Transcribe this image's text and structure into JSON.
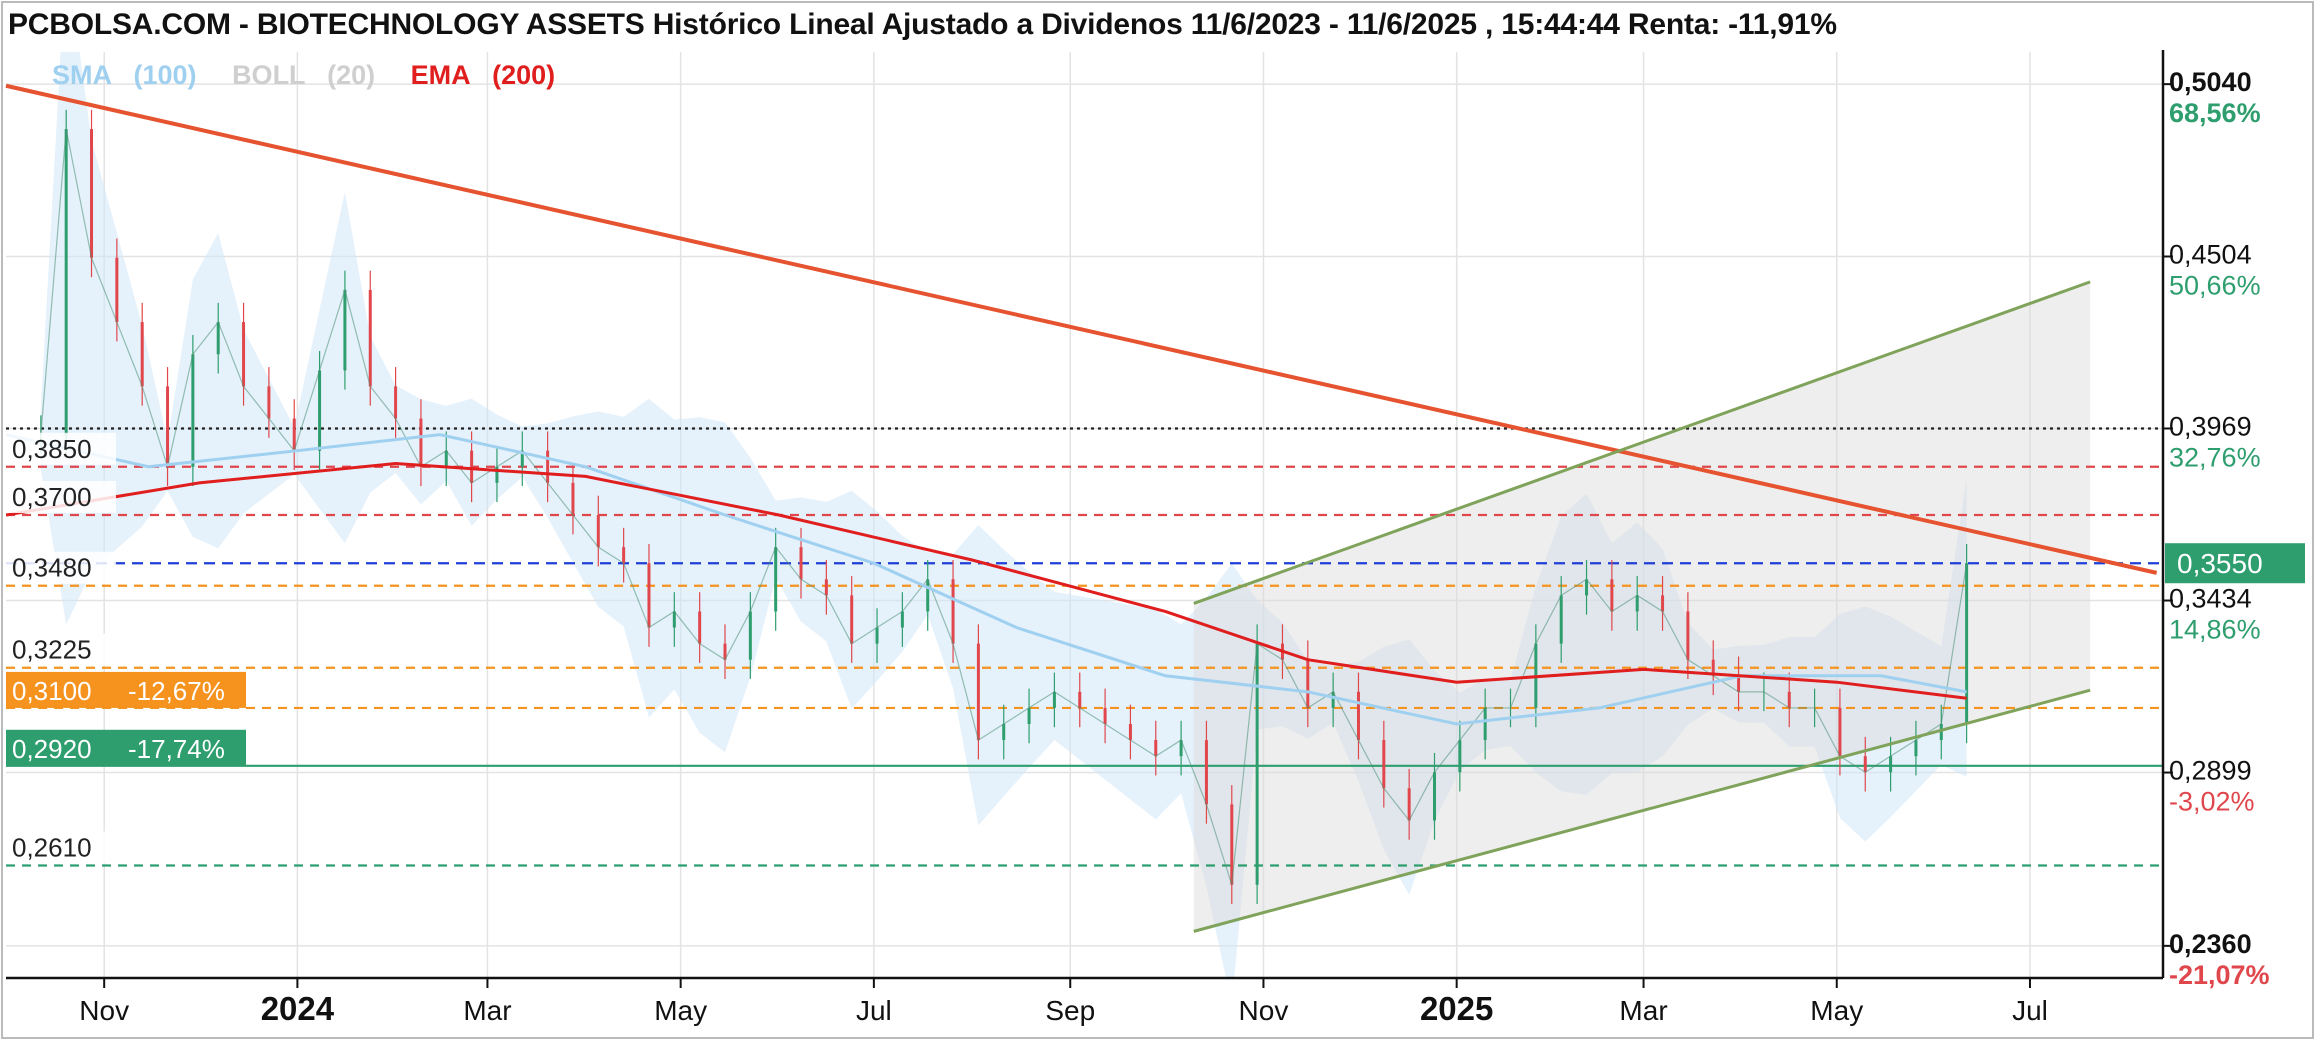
{
  "header": {
    "title": "PCBOLSA.COM - BIOTECHNOLOGY ASSETS Histórico Lineal Ajustado a Dividenos 11/6/2023 - 11/6/2025 , 15:44:44 Renta: -11,91%"
  },
  "legend": [
    {
      "label": "SMA",
      "param": "(100)",
      "color": "#9fd0f0"
    },
    {
      "label": "BOLL",
      "param": "(20)",
      "color": "#cfcfcf"
    },
    {
      "label": "EMA",
      "param": "(200)",
      "color": "#e01e1e"
    }
  ],
  "colors": {
    "up": "#2e9e6e",
    "down": "#e0474c",
    "ema": "#e01e1e",
    "sma": "#9fd0f0",
    "trend_red": "#e65330",
    "channel_green": "#7fa35a",
    "orange": "#f5931e",
    "green_level": "#2e9e6e",
    "blue_level": "#1f3fd6"
  },
  "chart_data": {
    "type": "line",
    "title": "BIOTECHNOLOGY ASSETS Histórico Lineal Ajustado a Dividenos 11/6/2023 - 11/6/2025",
    "x_range": [
      "2023-10-01",
      "2025-08-12"
    ],
    "ylim": [
      0.226,
      0.514
    ],
    "grid": true,
    "x_tick_labels": [
      {
        "label": "Nov",
        "date": "2023-11-01",
        "bold": false
      },
      {
        "label": "2024",
        "date": "2024-01-01",
        "bold": true
      },
      {
        "label": "Mar",
        "date": "2024-03-01",
        "bold": false
      },
      {
        "label": "May",
        "date": "2024-05-01",
        "bold": false
      },
      {
        "label": "Jul",
        "date": "2024-07-01",
        "bold": false
      },
      {
        "label": "Sep",
        "date": "2024-09-01",
        "bold": false
      },
      {
        "label": "Nov",
        "date": "2024-11-01",
        "bold": false
      },
      {
        "label": "2025",
        "date": "2025-01-01",
        "bold": true
      },
      {
        "label": "Mar",
        "date": "2025-03-01",
        "bold": false
      },
      {
        "label": "May",
        "date": "2025-05-01",
        "bold": false
      },
      {
        "label": "Jul",
        "date": "2025-07-01",
        "bold": false
      }
    ],
    "right_axis": [
      {
        "value": 0.504,
        "label": "0,5040",
        "pct": "68,56%",
        "bold": true,
        "pct_color": "#2e9e6e"
      },
      {
        "value": 0.4504,
        "label": "0,4504",
        "pct": "50,66%",
        "bold": false,
        "pct_color": "#2e9e6e"
      },
      {
        "value": 0.3969,
        "label": "0,3969",
        "pct": "32,76%",
        "bold": false,
        "pct_color": "#2e9e6e"
      },
      {
        "value": 0.3434,
        "label": "0,3434",
        "pct": "14,86%",
        "bold": false,
        "pct_color": "#2e9e6e"
      },
      {
        "value": 0.2899,
        "label": "0,2899",
        "pct": "-3,02%",
        "bold": false,
        "pct_color": "#e0474c"
      },
      {
        "value": 0.236,
        "label": "0,2360",
        "pct": "-21,07%",
        "bold": true,
        "pct_color": "#e0474c"
      }
    ],
    "last_price": {
      "value": 0.355,
      "label": "0,3550",
      "color": "#2e9e6e"
    },
    "levels": [
      {
        "value": 0.385,
        "label": "0,3850",
        "style": "dashed",
        "color": "#e0474c",
        "tag": ""
      },
      {
        "value": 0.37,
        "label": "0,3700",
        "style": "dashed",
        "color": "#e0474c",
        "tag": ""
      },
      {
        "value": 0.348,
        "label": "0,3480",
        "style": "dashed",
        "color": "#f5931e",
        "tag": ""
      },
      {
        "value": 0.3225,
        "label": "0,3225",
        "style": "dashed",
        "color": "#f5931e",
        "tag": ""
      },
      {
        "value": 0.31,
        "label": "0,3100",
        "style": "dashed",
        "color": "#f5931e",
        "tag": "-12,67%"
      },
      {
        "value": 0.292,
        "label": "0,2920",
        "style": "solid",
        "color": "#2e9e6e",
        "tag": "-17,74%"
      },
      {
        "value": 0.261,
        "label": "0,2610",
        "style": "dashed",
        "color": "#2e9e6e",
        "tag": ""
      }
    ],
    "extra_lines": [
      {
        "value": 0.3969,
        "style": "dotted",
        "color": "#222222"
      },
      {
        "value": 0.355,
        "style": "dashed",
        "color": "#1f3fd6"
      }
    ],
    "trendline": {
      "from": [
        "2023-10-01",
        0.5035
      ],
      "to": [
        "2025-08-10",
        0.352
      ]
    },
    "channel": {
      "upper": {
        "from": [
          "2024-10-10",
          0.3425
        ],
        "to": [
          "2025-07-20",
          0.4425
        ]
      },
      "lower": {
        "from": [
          "2024-10-10",
          0.2405
        ],
        "to": [
          "2025-07-20",
          0.3155
        ]
      }
    },
    "series": [
      {
        "name": "Close",
        "kind": "price",
        "x": [
          "2023-10-12",
          "2023-10-20",
          "2023-10-28",
          "2023-11-05",
          "2023-11-13",
          "2023-11-21",
          "2023-11-29",
          "2023-12-07",
          "2023-12-15",
          "2023-12-23",
          "2023-12-31",
          "2024-01-08",
          "2024-01-16",
          "2024-01-24",
          "2024-02-01",
          "2024-02-09",
          "2024-02-17",
          "2024-02-25",
          "2024-03-04",
          "2024-03-12",
          "2024-03-20",
          "2024-03-28",
          "2024-04-05",
          "2024-04-13",
          "2024-04-21",
          "2024-04-29",
          "2024-05-07",
          "2024-05-15",
          "2024-05-23",
          "2024-05-31",
          "2024-06-08",
          "2024-06-16",
          "2024-06-24",
          "2024-07-02",
          "2024-07-10",
          "2024-07-18",
          "2024-07-26",
          "2024-08-03",
          "2024-08-11",
          "2024-08-19",
          "2024-08-27",
          "2024-09-04",
          "2024-09-12",
          "2024-09-20",
          "2024-09-28",
          "2024-10-06",
          "2024-10-14",
          "2024-10-22",
          "2024-10-30",
          "2024-11-07",
          "2024-11-15",
          "2024-11-23",
          "2024-12-01",
          "2024-12-09",
          "2024-12-17",
          "2024-12-25",
          "2025-01-02",
          "2025-01-10",
          "2025-01-18",
          "2025-01-26",
          "2025-02-03",
          "2025-02-11",
          "2025-02-19",
          "2025-02-27",
          "2025-03-07",
          "2025-03-15",
          "2025-03-23",
          "2025-03-31",
          "2025-04-08",
          "2025-04-16",
          "2025-04-24",
          "2025-05-02",
          "2025-05-10",
          "2025-05-18",
          "2025-05-26",
          "2025-06-03",
          "2025-06-11"
        ],
        "values": [
          0.395,
          0.49,
          0.45,
          0.43,
          0.41,
          0.385,
          0.42,
          0.43,
          0.41,
          0.4,
          0.39,
          0.415,
          0.44,
          0.41,
          0.4,
          0.385,
          0.39,
          0.38,
          0.385,
          0.39,
          0.38,
          0.37,
          0.36,
          0.355,
          0.335,
          0.34,
          0.33,
          0.325,
          0.34,
          0.36,
          0.35,
          0.345,
          0.33,
          0.335,
          0.34,
          0.35,
          0.33,
          0.3,
          0.305,
          0.31,
          0.315,
          0.31,
          0.305,
          0.3,
          0.295,
          0.3,
          0.28,
          0.255,
          0.33,
          0.325,
          0.31,
          0.315,
          0.3,
          0.285,
          0.275,
          0.29,
          0.3,
          0.31,
          0.31,
          0.33,
          0.345,
          0.35,
          0.34,
          0.345,
          0.34,
          0.325,
          0.32,
          0.315,
          0.315,
          0.31,
          0.31,
          0.295,
          0.29,
          0.295,
          0.3,
          0.305,
          0.355
        ]
      },
      {
        "name": "SMA (100)",
        "kind": "sma",
        "x": [
          "2023-10-01",
          "2023-11-15",
          "2024-01-01",
          "2024-02-15",
          "2024-04-01",
          "2024-05-15",
          "2024-07-01",
          "2024-08-15",
          "2024-10-01",
          "2024-11-15",
          "2025-01-01",
          "2025-02-15",
          "2025-04-01",
          "2025-05-15",
          "2025-06-11"
        ],
        "values": [
          0.395,
          0.385,
          0.39,
          0.395,
          0.385,
          0.37,
          0.355,
          0.335,
          0.32,
          0.315,
          0.305,
          0.31,
          0.32,
          0.32,
          0.315
        ]
      },
      {
        "name": "EMA (200)",
        "kind": "ema",
        "x": [
          "2023-10-01",
          "2023-12-01",
          "2024-02-01",
          "2024-04-01",
          "2024-06-01",
          "2024-08-01",
          "2024-10-01",
          "2024-11-15",
          "2025-01-01",
          "2025-03-01",
          "2025-05-01",
          "2025-06-11"
        ],
        "values": [
          0.37,
          0.38,
          0.386,
          0.382,
          0.37,
          0.356,
          0.34,
          0.325,
          0.318,
          0.322,
          0.318,
          0.313
        ]
      }
    ]
  }
}
